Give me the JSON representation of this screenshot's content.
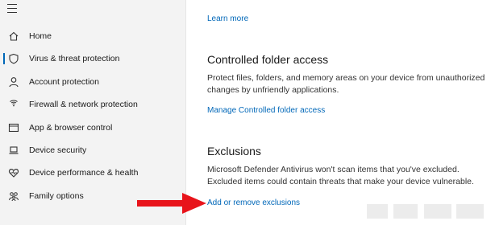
{
  "sidebar": {
    "items": [
      {
        "label": "Home",
        "icon": "home-icon"
      },
      {
        "label": "Virus & threat protection",
        "icon": "shield-icon",
        "active": true
      },
      {
        "label": "Account protection",
        "icon": "person-icon"
      },
      {
        "label": "Firewall & network protection",
        "icon": "wifi-icon"
      },
      {
        "label": "App & browser control",
        "icon": "window-icon"
      },
      {
        "label": "Device security",
        "icon": "laptop-icon"
      },
      {
        "label": "Device performance & health",
        "icon": "heart-icon"
      },
      {
        "label": "Family options",
        "icon": "family-icon"
      }
    ]
  },
  "main": {
    "learn_more": "Learn more",
    "controlled_folder": {
      "title": "Controlled folder access",
      "description": "Protect files, folders, and memory areas on your device from unauthorized changes by unfriendly applications.",
      "link": "Manage Controlled folder access"
    },
    "exclusions": {
      "title": "Exclusions",
      "description": "Microsoft Defender Antivirus won't scan items that you've excluded. Excluded items could contain threats that make your device vulnerable.",
      "link": "Add or remove exclusions"
    }
  },
  "colors": {
    "accent": "#0067b8",
    "arrow": "#e8141b",
    "sidebar_bg": "#f3f3f3"
  }
}
